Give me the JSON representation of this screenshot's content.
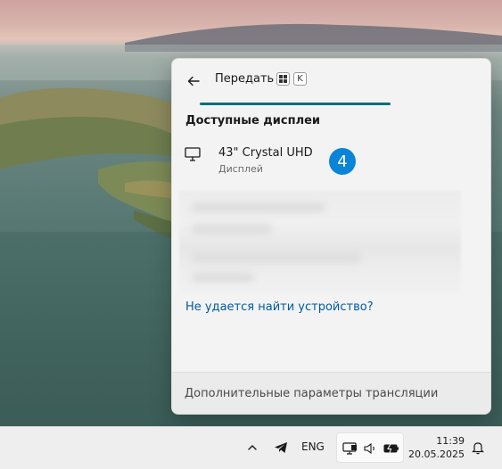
{
  "flyout": {
    "title": "Передать",
    "shortcut": {
      "win_key": "⊞",
      "key": "K"
    },
    "section_heading": "Доступные дисплеи",
    "devices": [
      {
        "name": "43\" Crystal UHD",
        "type": "Дисплей",
        "icon": "monitor-icon"
      }
    ],
    "badge": "4",
    "help_link": "Не удается найти устройство?",
    "footer_link": "Дополнительные параметры трансляции"
  },
  "taskbar": {
    "language": "ENG",
    "time": "11:39",
    "date": "20.05.2025",
    "icons": [
      "chevron-up-icon",
      "telegram-icon",
      "cast-icon",
      "volume-icon",
      "battery-icon",
      "bell-icon"
    ]
  },
  "colors": {
    "accent": "#006f7a",
    "link": "#005a9e",
    "badge": "#0a84d6",
    "flyout_bg": "#f3f3f3",
    "taskbar_bg": "#eeeeee"
  }
}
